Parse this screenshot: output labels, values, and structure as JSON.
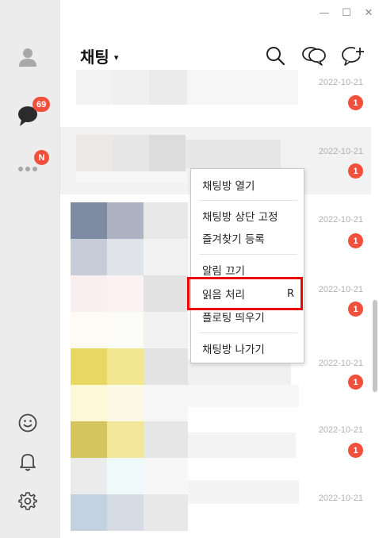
{
  "window": {
    "minimize": "—",
    "maximize": "☐",
    "close": "✕"
  },
  "sidebar": {
    "items": [
      {
        "name": "friends",
        "icon": "person-icon"
      },
      {
        "name": "chats",
        "icon": "chat-bubble-icon",
        "badge": "69"
      },
      {
        "name": "more",
        "icon": "more-dots-icon",
        "badge": "N"
      }
    ],
    "bottom": [
      {
        "name": "emoticon",
        "icon": "smiley-icon"
      },
      {
        "name": "notifications",
        "icon": "bell-icon"
      },
      {
        "name": "settings",
        "icon": "gear-icon"
      }
    ]
  },
  "header": {
    "title": "채팅",
    "caret": "▾",
    "actions": [
      "search-icon",
      "open-chat-icon",
      "new-chat-icon"
    ]
  },
  "chats": [
    {
      "date": "2022-10-21",
      "unread": "1"
    },
    {
      "date": "2022-10-21",
      "unread": "1"
    },
    {
      "date": "2022-10-21",
      "unread": "1"
    },
    {
      "date": "2022-10-21",
      "unread": "1"
    },
    {
      "date": "2022-10-21",
      "unread": "1"
    },
    {
      "date": "2022-10-21",
      "unread": "1"
    },
    {
      "date": "2022-10-21",
      "unread": "1"
    }
  ],
  "context_menu": {
    "open": "채팅방 열기",
    "pin_top": "채팅방 상단 고정",
    "add_favorite": "즐겨찾기 등록",
    "mute": "알림 끄기",
    "mark_read": "읽음 처리",
    "mark_read_shortcut": "R",
    "floating": "플로팅 띄우기",
    "leave": "채팅방 나가기"
  },
  "colors": {
    "badge": "#f0503c",
    "highlight": "#f00000",
    "rail": "#ececec"
  }
}
